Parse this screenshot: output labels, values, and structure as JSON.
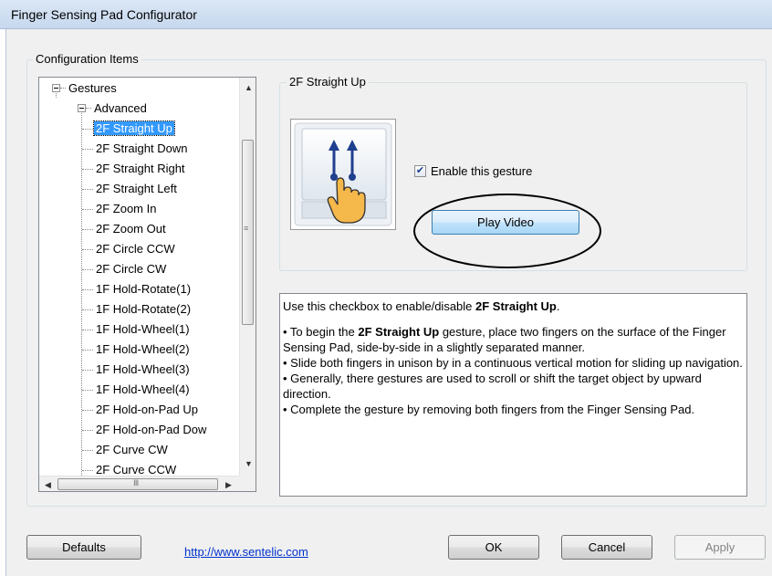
{
  "window": {
    "title": "Finger Sensing Pad Configurator"
  },
  "config_group": {
    "label": "Configuration Items"
  },
  "tree": {
    "root": "Gestures",
    "child": "Advanced",
    "items": [
      "2F Straight Up",
      "2F Straight Down",
      "2F Straight Right",
      "2F Straight Left",
      "2F Zoom In",
      "2F Zoom Out",
      "2F Circle CCW",
      "2F Circle CW",
      "1F Hold-Rotate(1)",
      "1F Hold-Rotate(2)",
      "1F Hold-Wheel(1)",
      "1F Hold-Wheel(2)",
      "1F Hold-Wheel(3)",
      "1F Hold-Wheel(4)",
      "2F Hold-on-Pad Up",
      "2F Hold-on-Pad Dow",
      "2F Curve CW",
      "2F Curve CCW"
    ],
    "selected": "2F Straight Up"
  },
  "gesture_panel": {
    "title": "2F Straight Up",
    "enable_label": "Enable this gesture",
    "enabled": true,
    "play_button": "Play Video"
  },
  "description": {
    "intro_prefix": "Use this checkbox to enable/disable ",
    "intro_bold": "2F Straight Up",
    "intro_suffix": ".",
    "b1_prefix": "• To begin the ",
    "b1_bold": "2F Straight Up",
    "b1_suffix": " gesture, place two fingers on the surface of the Finger Sensing Pad, side-by-side in a slightly separated manner.",
    "b2": "• Slide both fingers in unison by in a continuous vertical motion for sliding up navigation.",
    "b3": "• Generally, there gestures are used to scroll or shift the target object by upward direction.",
    "b4": "• Complete the gesture by removing both fingers from the Finger Sensing Pad."
  },
  "footer": {
    "defaults": "Defaults",
    "link": "http://www.sentelic.com",
    "ok": "OK",
    "cancel": "Cancel",
    "apply": "Apply"
  },
  "colors": {
    "selection": "#3399ff",
    "link": "#0033cc",
    "accent_arrow": "#1f3f8f",
    "hand": "#f5b84a"
  }
}
